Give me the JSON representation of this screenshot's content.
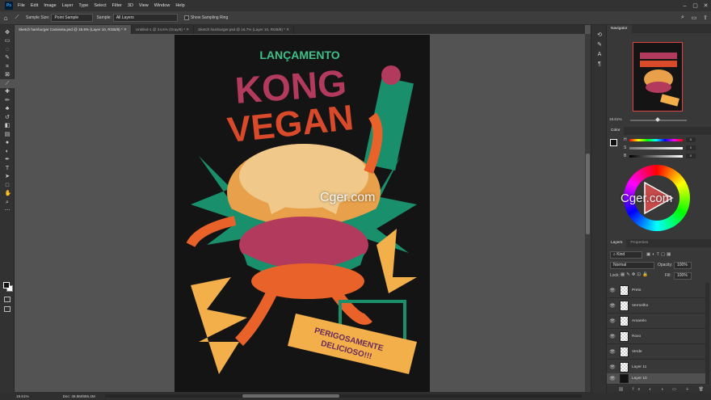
{
  "menubar": {
    "items": [
      "File",
      "Edit",
      "Image",
      "Layer",
      "Type",
      "Select",
      "Filter",
      "3D",
      "View",
      "Window",
      "Help"
    ]
  },
  "options": {
    "sample_size_label": "Sample Size:",
    "sample_size_value": "Point Sample",
    "sample_label": "Sample:",
    "sample_value": "All Layers",
    "show_ring_label": "Show Sampling Ring"
  },
  "tabs": [
    {
      "label": "Sketch hamburger Camiseta.psd @ 19.6% (Layer 10, RGB/8) *",
      "active": true
    },
    {
      "label": "Untitled-1 @ 24.6% (Gray/8) *",
      "active": false
    },
    {
      "label": "Sketch hamburger.psd @ 16.7% (Layer 10, RGB/8) *",
      "active": false
    }
  ],
  "artwork": {
    "top_word": "LANÇAMENTO",
    "line1": "KONG",
    "line2": "VEGAN",
    "banner1": "PERIGOSAMENTE",
    "banner2": "DELICIOSO!!!",
    "colors": {
      "bg": "#141414",
      "magenta": "#b23a5c",
      "orange": "#e8622a",
      "green": "#1a8f6b",
      "yellow": "#f3b04a",
      "cream": "#f0c98a"
    }
  },
  "watermark": "Cger.com",
  "status": {
    "zoom": "19.61%",
    "doc": "Doc: 49.8M/855.4M"
  },
  "navigator": {
    "tab": "Navigator",
    "zoom": "19.61%"
  },
  "color_panel": {
    "tab": "Color",
    "sliders": [
      {
        "label": "H",
        "value": "0"
      },
      {
        "label": "S",
        "value": "0"
      },
      {
        "label": "B",
        "value": "0"
      }
    ]
  },
  "layers_panel": {
    "tabs": [
      "Layers",
      "Properties"
    ],
    "filter": "Kind",
    "blend_mode": "Normal",
    "opacity_label": "Opacity:",
    "opacity_value": "100%",
    "lock_label": "Lock:",
    "fill_label": "Fill:",
    "fill_value": "100%",
    "layers": [
      "Preto",
      "Vermelho",
      "Amarelo",
      "Roxo",
      "Verde",
      "Layer 11",
      "Layer 10"
    ]
  }
}
